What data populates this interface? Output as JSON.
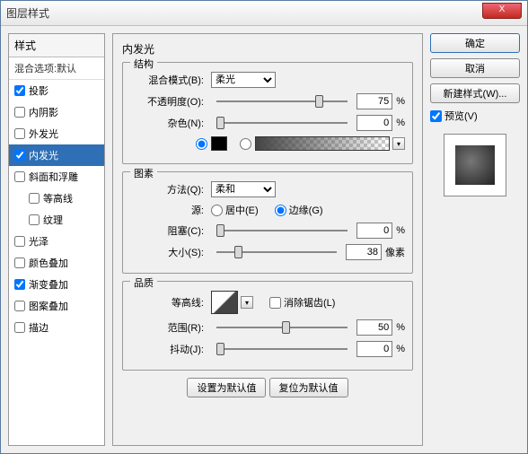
{
  "window": {
    "title": "图层样式",
    "close": "X"
  },
  "sidebar": {
    "header": "样式",
    "blend_options": "混合选项:默认",
    "items": [
      {
        "label": "投影",
        "checked": true
      },
      {
        "label": "内阴影",
        "checked": false
      },
      {
        "label": "外发光",
        "checked": false
      },
      {
        "label": "内发光",
        "checked": true,
        "selected": true
      },
      {
        "label": "斜面和浮雕",
        "checked": false
      },
      {
        "label": "等高线",
        "checked": false,
        "indent": true
      },
      {
        "label": "纹理",
        "checked": false,
        "indent": true
      },
      {
        "label": "光泽",
        "checked": false
      },
      {
        "label": "颜色叠加",
        "checked": false
      },
      {
        "label": "渐变叠加",
        "checked": true
      },
      {
        "label": "图案叠加",
        "checked": false
      },
      {
        "label": "描边",
        "checked": false
      }
    ]
  },
  "main": {
    "title": "内发光",
    "structure": {
      "legend": "结构",
      "blend_mode_label": "混合模式(B):",
      "blend_mode_value": "柔光",
      "opacity_label": "不透明度(O):",
      "opacity_value": "75",
      "opacity_unit": "%",
      "noise_label": "杂色(N):",
      "noise_value": "0",
      "noise_unit": "%"
    },
    "elements": {
      "legend": "图素",
      "method_label": "方法(Q):",
      "method_value": "柔和",
      "source_label": "源:",
      "source_center": "居中(E)",
      "source_edge": "边缘(G)",
      "choke_label": "阻塞(C):",
      "choke_value": "0",
      "choke_unit": "%",
      "size_label": "大小(S):",
      "size_value": "38",
      "size_unit": "像素"
    },
    "quality": {
      "legend": "品质",
      "contour_label": "等高线:",
      "antialias_label": "消除锯齿(L)",
      "range_label": "范围(R):",
      "range_value": "50",
      "range_unit": "%",
      "jitter_label": "抖动(J):",
      "jitter_value": "0",
      "jitter_unit": "%"
    },
    "buttons": {
      "make_default": "设置为默认值",
      "reset_default": "复位为默认值"
    }
  },
  "right": {
    "ok": "确定",
    "cancel": "取消",
    "new_style": "新建样式(W)...",
    "preview_label": "预览(V)"
  }
}
